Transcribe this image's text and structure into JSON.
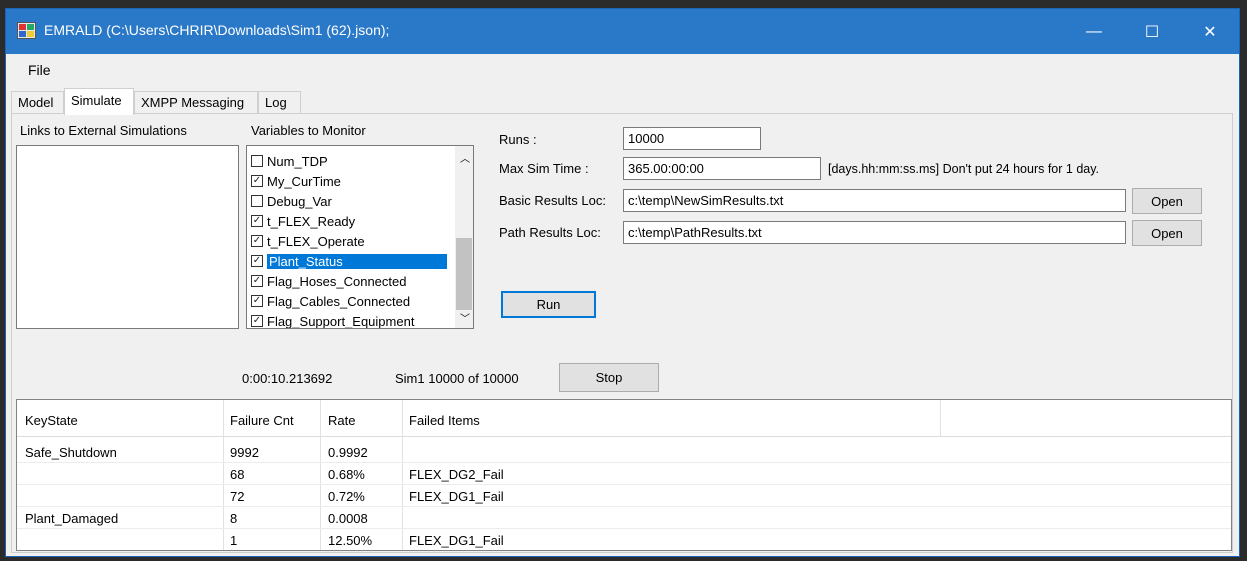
{
  "window": {
    "title": "EMRALD (C:\\Users\\CHRIR\\Downloads\\Sim1 (62).json);",
    "controls": {
      "minimize": "—",
      "maximize": "☐",
      "close": "✕"
    }
  },
  "menu": {
    "file": "File"
  },
  "tabs": [
    {
      "label": "Model"
    },
    {
      "label": "Simulate"
    },
    {
      "label": "XMPP Messaging"
    },
    {
      "label": "Log"
    }
  ],
  "panels": {
    "links_title": "Links to External Simulations",
    "vars_title": "Variables to Monitor"
  },
  "variables": [
    {
      "name": "Num_TDP",
      "checked": false,
      "selected": false
    },
    {
      "name": "My_CurTime",
      "checked": true,
      "selected": false
    },
    {
      "name": "Debug_Var",
      "checked": false,
      "selected": false
    },
    {
      "name": "t_FLEX_Ready",
      "checked": true,
      "selected": false
    },
    {
      "name": "t_FLEX_Operate",
      "checked": true,
      "selected": false
    },
    {
      "name": "Plant_Status",
      "checked": true,
      "selected": true
    },
    {
      "name": "Flag_Hoses_Connected",
      "checked": true,
      "selected": false
    },
    {
      "name": "Flag_Cables_Connected",
      "checked": true,
      "selected": false
    },
    {
      "name": "Flag_Support_Equipment",
      "checked": true,
      "selected": false
    }
  ],
  "settings": {
    "runs_label": "Runs :",
    "runs_value": "10000",
    "max_time_label": "Max Sim Time :",
    "max_time_value": "365.00:00:00",
    "time_hint": "[days.hh:mm:ss.ms]  Don't put 24 hours for 1 day.",
    "basic_loc_label": "Basic Results Loc:",
    "basic_loc_value": "c:\\temp\\NewSimResults.txt",
    "path_loc_label": "Path Results Loc:",
    "path_loc_value": "c:\\temp\\PathResults.txt",
    "open_label": "Open",
    "run_label": "Run"
  },
  "status": {
    "elapsed": "0:00:10.213692",
    "progress": "Sim1 10000 of 10000",
    "stop_label": "Stop"
  },
  "results": {
    "columns": [
      "KeyState",
      "Failure Cnt",
      "Rate",
      "Failed Items"
    ],
    "rows": [
      [
        "Safe_Shutdown",
        "9992",
        "0.9992",
        ""
      ],
      [
        "",
        "68",
        "0.68%",
        "FLEX_DG2_Fail"
      ],
      [
        "",
        "72",
        "0.72%",
        "FLEX_DG1_Fail"
      ],
      [
        "Plant_Damaged",
        "8",
        "0.0008",
        ""
      ],
      [
        "",
        "1",
        "12.50%",
        "FLEX_DG1_Fail"
      ]
    ]
  },
  "colors": {
    "title_bar": "#2a78c8",
    "selection": "#0078d7"
  }
}
